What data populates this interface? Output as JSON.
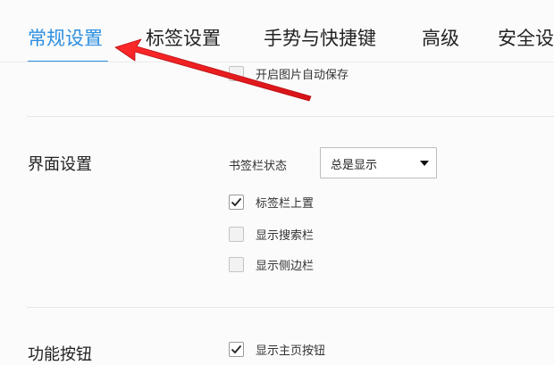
{
  "tabs": [
    {
      "label": "常规设置",
      "active": true
    },
    {
      "label": "标签设置",
      "active": false
    },
    {
      "label": "手势与快捷键",
      "active": false
    },
    {
      "label": "高级",
      "active": false
    },
    {
      "label": "安全设",
      "active": false
    }
  ],
  "top_option": {
    "label": "开启图片自动保存",
    "checked": false
  },
  "interface_section": {
    "title": "界面设置",
    "bookmark_bar_label": "书签栏状态",
    "bookmark_bar_select": {
      "value": "总是显示"
    },
    "options": [
      {
        "label": "标签栏上置",
        "checked": true
      },
      {
        "label": "显示搜索栏",
        "checked": false
      },
      {
        "label": "显示侧边栏",
        "checked": false
      }
    ]
  },
  "function_section": {
    "title": "功能按钮",
    "options": [
      {
        "label": "显示主页按钮",
        "checked": true
      }
    ]
  },
  "colors": {
    "accent": "#2d8fe0",
    "annotation_arrow": "#e8191f"
  },
  "icons": [
    "checkmark-icon",
    "dropdown-arrow-icon",
    "annotation-arrow"
  ]
}
